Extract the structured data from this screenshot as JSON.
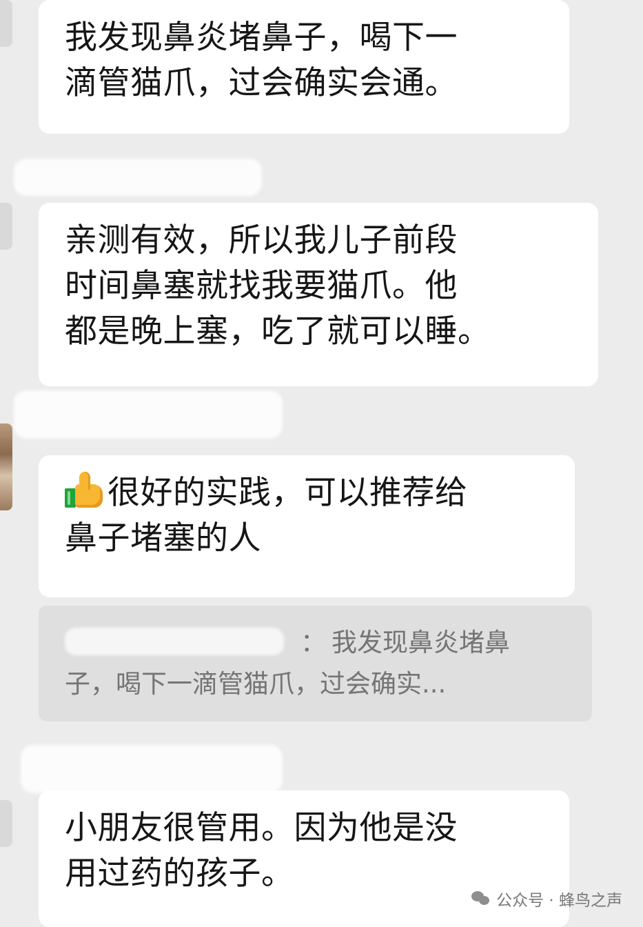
{
  "messages": [
    {
      "lines": [
        "我发现鼻炎堵鼻子，喝下一",
        "滴管猫爪，过会确实会通。"
      ]
    },
    {
      "lines": [
        "亲测有效，所以我儿子前段",
        "时间鼻塞就找我要猫爪。他",
        "都是晚上塞，吃了就可以睡。"
      ]
    },
    {
      "icon": "thumbs-up-icon",
      "lines": [
        "很好的实践，可以推荐给",
        "鼻子堵塞的人"
      ]
    },
    {
      "lines": [
        "小朋友很管用。因为他是没",
        "用过药的孩子。"
      ]
    }
  ],
  "reply_quote": {
    "colon": "：",
    "lines": [
      "我发现鼻炎堵鼻",
      "子，喝下一滴管猫爪，过会确实..."
    ]
  },
  "watermark": {
    "text": "公众号 · 蜂鸟之声"
  },
  "colors": {
    "background": "#ececec",
    "bubble": "#ffffff",
    "quote_background": "#dfdfdf",
    "quote_text": "#747474",
    "message_text": "#161616"
  }
}
